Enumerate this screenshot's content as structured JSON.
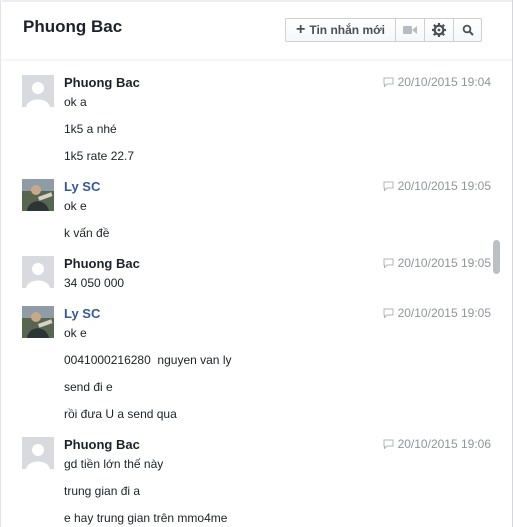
{
  "header": {
    "title": "Phuong Bac",
    "new_message_label": "Tin nhắn mới",
    "icons": [
      "plus-icon",
      "video-icon",
      "gear-icon",
      "search-icon"
    ]
  },
  "colors": {
    "sender_blue": "#365899",
    "timestamp_gray": "#90949c",
    "text": "#1d2129"
  },
  "messages": [
    {
      "sender": "Phuong Bac",
      "time": "20/10/2015 19:04",
      "lines": [
        "ok a",
        "1k5 a nhé",
        "1k5 rate 22.7"
      ]
    },
    {
      "sender": "Ly SC",
      "time": "20/10/2015 19:05",
      "lines": [
        "ok e",
        "k vấn đề"
      ]
    },
    {
      "sender": "Phuong Bac",
      "time": "20/10/2015 19:05",
      "lines": [
        "34 050 000"
      ]
    },
    {
      "sender": "Ly SC",
      "time": "20/10/2015 19:05",
      "lines": [
        "ok e",
        "0041000216280  nguyen van ly",
        "send đi e",
        "rồi đưa U a send qua"
      ]
    },
    {
      "sender": "Phuong Bac",
      "time": "20/10/2015 19:06",
      "lines": [
        "gd tiền lớn thế này",
        "trung gian đi a",
        "e hay trung gian trên mmo4me"
      ]
    }
  ]
}
